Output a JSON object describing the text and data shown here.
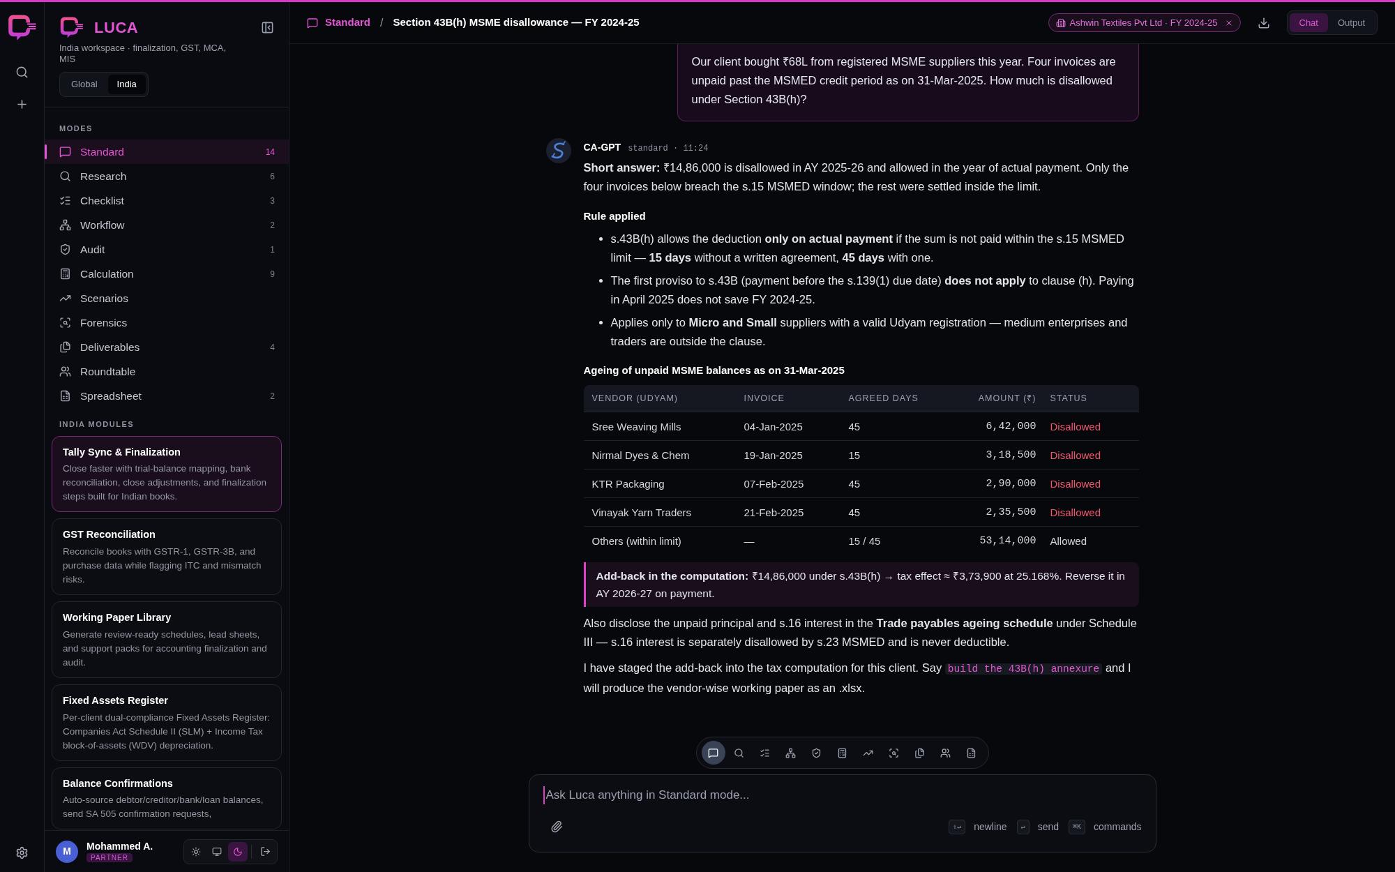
{
  "brand": {
    "name": "LUCA",
    "subtitle": "India workspace · finalization, GST, MCA, MIS"
  },
  "region_toggle": [
    {
      "label": "Global",
      "selected": false
    },
    {
      "label": "India",
      "selected": true
    }
  ],
  "modes_heading": "MODES",
  "modes": [
    {
      "label": "Standard",
      "count": "14",
      "selected": true
    },
    {
      "label": "Research",
      "count": "6",
      "selected": false
    },
    {
      "label": "Checklist",
      "count": "3",
      "selected": false
    },
    {
      "label": "Workflow",
      "count": "2",
      "selected": false
    },
    {
      "label": "Audit",
      "count": "1",
      "selected": false
    },
    {
      "label": "Calculation",
      "count": "9",
      "selected": false
    },
    {
      "label": "Scenarios",
      "selected": false
    },
    {
      "label": "Forensics",
      "selected": false
    },
    {
      "label": "Deliverables",
      "count": "4",
      "selected": false
    },
    {
      "label": "Roundtable",
      "selected": false
    },
    {
      "label": "Spreadsheet",
      "count": "2",
      "selected": false
    }
  ],
  "modules_heading": "INDIA MODULES",
  "modules": [
    {
      "title": "Tally Sync & Finalization",
      "description": "Close faster with trial-balance mapping, bank reconciliation, close adjustments, and finalization steps built for Indian books.",
      "selected": true
    },
    {
      "title": "GST Reconciliation",
      "description": "Reconcile books with GSTR-1, GSTR-3B, and purchase data while flagging ITC and mismatch risks.",
      "selected": false
    },
    {
      "title": "Working Paper Library",
      "description": "Generate review-ready schedules, lead sheets, and support packs for accounting finalization and audit.",
      "selected": false
    },
    {
      "title": "Fixed Assets Register",
      "description": "Per-client dual-compliance Fixed Assets Register: Companies Act Schedule II (SLM) + Income Tax block-of-assets (WDV) depreciation.",
      "selected": false
    },
    {
      "title": "Balance Confirmations",
      "description": "Auto-source debtor/creditor/bank/loan balances, send SA 505 confirmation requests,",
      "selected": false
    }
  ],
  "user": {
    "initial": "M",
    "name": "Mohammed A.",
    "role": "PARTNER"
  },
  "theme_switch": [
    {
      "selected": false
    },
    {
      "selected": false
    },
    {
      "selected": true
    }
  ],
  "breadcrumb": {
    "mode": "Standard",
    "separator": "/",
    "title": "Section 43B(h) MSME disallowance — FY 2024-25"
  },
  "client_chip": "Ashwin Textiles Pvt Ltd · FY 2024-25",
  "view_toggle": [
    {
      "label": "Chat",
      "selected": true
    },
    {
      "label": "Output",
      "selected": false
    }
  ],
  "user_message": "Our client bought ₹68L from registered MSME suppliers this year. Four invoices are unpaid past the MSMED credit period as on 31-Mar-2025. How much is disallowed under Section 43B(h)?",
  "assistant": {
    "name": "CA-GPT",
    "meta": "standard · 11:24",
    "short_answer": "**Short answer:** ₹14,86,000 is disallowed in AY 2025-26 and allowed in the year of actual payment. Only the four invoices below breach the s.15 MSMED window; the rest were settled inside the limit.",
    "rule_heading": "Rule applied",
    "rules": [
      "s.43B(h) allows the deduction **only on actual payment** if the sum is not paid within the s.15 MSMED limit — **15 days** without a written agreement, **45 days** with one.",
      "The first proviso to s.43B (payment before the s.139(1) due date) **does not apply** to clause (h). Paying in April 2025 does not save FY 2024-25.",
      "Applies only to **Micro and Small** suppliers with a valid Udyam registration — medium enterprises and traders are outside the clause."
    ],
    "table_heading": "Ageing of unpaid MSME balances as on 31-Mar-2025",
    "table": {
      "columns": [
        "VENDOR (UDYAM)",
        "INVOICE",
        "AGREED DAYS",
        "AMOUNT (₹)",
        "STATUS"
      ],
      "rows": [
        {
          "vendor": "Sree Weaving Mills",
          "invoice": "04-Jan-2025",
          "days": "45",
          "amount": "6,42,000",
          "status": "Disallowed",
          "kind": "disallowed"
        },
        {
          "vendor": "Nirmal Dyes & Chem",
          "invoice": "19-Jan-2025",
          "days": "15",
          "amount": "3,18,500",
          "status": "Disallowed",
          "kind": "disallowed"
        },
        {
          "vendor": "KTR Packaging",
          "invoice": "07-Feb-2025",
          "days": "45",
          "amount": "2,90,000",
          "status": "Disallowed",
          "kind": "disallowed"
        },
        {
          "vendor": "Vinayak Yarn Traders",
          "invoice": "21-Feb-2025",
          "days": "45",
          "amount": "2,35,500",
          "status": "Disallowed",
          "kind": "disallowed"
        },
        {
          "vendor": "Others (within limit)",
          "invoice": "—",
          "days": "15 / 45",
          "amount": "53,14,000",
          "status": "Allowed",
          "kind": "allowed"
        }
      ]
    },
    "callout": "**Add-back in the computation:** ₹14,86,000 under s.43B(h) → tax effect ≈ ₹3,73,900 at 25.168%. Reverse it in AY 2026-27 on payment.",
    "disclosure": "Also disclose the unpaid principal and s.16 interest in the **Trade payables ageing schedule** under Schedule III — s.16 interest is separately disallowed by s.23 MSMED and is never deductible.",
    "closing": {
      "before": "I have staged the add-back into the tax computation for this client. Say",
      "code": "build the 43B(h) annexure",
      "after": "and I will produce the vendor-wise working paper as an .xlsx."
    }
  },
  "mode_toolbar": [
    {
      "selected": true
    },
    {
      "selected": false
    },
    {
      "selected": false
    },
    {
      "selected": false
    },
    {
      "selected": false
    },
    {
      "selected": false
    },
    {
      "selected": false
    },
    {
      "selected": false
    },
    {
      "selected": false
    },
    {
      "selected": false
    },
    {
      "selected": false
    }
  ],
  "composer": {
    "placeholder": "Ask Luca anything in Standard mode...",
    "shortcuts": [
      {
        "key": "⇧↵",
        "label": "newline"
      },
      {
        "key": "↵",
        "label": "send"
      },
      {
        "key": "⌘K",
        "label": "commands"
      }
    ]
  }
}
